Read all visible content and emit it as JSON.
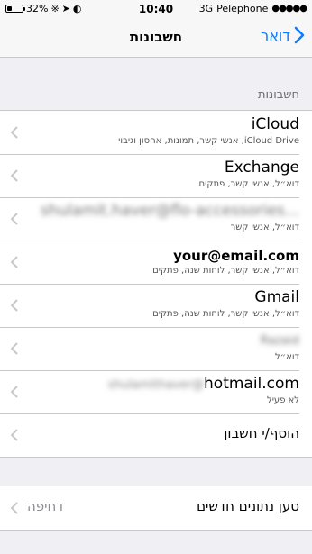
{
  "status_bar": {
    "battery_percent": "32%",
    "time": "10:40",
    "network": "3G",
    "carrier": "Pelephone",
    "battery_level": 0.32
  },
  "nav": {
    "title": "חשבונות",
    "back_label": "דואר"
  },
  "section_header": "חשבונות",
  "accounts": [
    {
      "title": "iCloud",
      "subtitle": "iCloud Drive, אנשי קשר, תמונות, אחסון וגיבוי"
    },
    {
      "title": "Exchange",
      "subtitle": "דוא״ל, אנשי קשר, פתקים"
    },
    {
      "title": "shulamit.haver@flo-accessories...",
      "subtitle": "דוא״ל, אנשי קשר"
    },
    {
      "title": "your@email.com",
      "subtitle": "דוא״ל, אנשי קשר, לוחות שנה, פתקים"
    },
    {
      "title": "Gmail",
      "subtitle": "דוא״ל, אנשי קשר, לוחות שנה, פתקים"
    },
    {
      "title": "Razaid",
      "subtitle": "דוא״ל"
    },
    {
      "title_blurred_part": "shulamithaver@",
      "title_visible_part": "hotmail.com",
      "subtitle": "לא פעיל"
    }
  ],
  "add_account_label": "הוסף/י חשבון",
  "fetch": {
    "label": "טען נתונים חדשים",
    "value": "דחיפה"
  },
  "colors": {
    "accent": "#0a7cff",
    "background": "#efeff4",
    "separator": "#c8c7cc",
    "chevron": "#c7c7cc"
  }
}
